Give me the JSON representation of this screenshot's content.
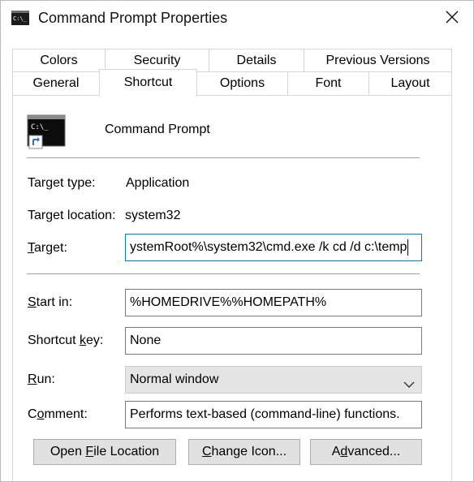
{
  "window": {
    "title": "Command Prompt Properties",
    "icon": "cmd-icon",
    "close_icon": "close-icon"
  },
  "tabs": {
    "row1": [
      {
        "label": "Colors"
      },
      {
        "label": "Security"
      },
      {
        "label": "Details"
      },
      {
        "label": "Previous Versions"
      }
    ],
    "row2": [
      {
        "label": "General"
      },
      {
        "label": "Shortcut",
        "active": true
      },
      {
        "label": "Options"
      },
      {
        "label": "Font"
      },
      {
        "label": "Layout"
      }
    ]
  },
  "shortcut": {
    "name": "Command Prompt",
    "target_type_label": "Target type:",
    "target_type_value": "Application",
    "target_location_label": "Target location:",
    "target_location_value": "system32",
    "target_label_u": "T",
    "target_label_rest": "arget:",
    "target_value": "ystemRoot%\\system32\\cmd.exe /k cd /d c:\\temp",
    "start_in_label_u": "S",
    "start_in_label_rest": "tart in:",
    "start_in_value": "%HOMEDRIVE%%HOMEPATH%",
    "shortcut_key_label_pre": "Shortcut ",
    "shortcut_key_label_u": "k",
    "shortcut_key_label_rest": "ey:",
    "shortcut_key_value": "None",
    "run_label_u": "R",
    "run_label_rest": "un:",
    "run_value": "Normal window",
    "comment_label_pre": "C",
    "comment_label_u": "o",
    "comment_label_rest": "mment:",
    "comment_value": "Performs text-based (command-line) functions."
  },
  "buttons": {
    "open_location_pre": "Open ",
    "open_location_u": "F",
    "open_location_rest": "ile Location",
    "change_icon_u": "C",
    "change_icon_rest": "hange Icon...",
    "advanced_pre": "A",
    "advanced_u": "d",
    "advanced_rest": "vanced..."
  },
  "colors": {
    "focus_border": "#0078d7",
    "button_face": "#e1e1e1",
    "dropdown_face": "#e5e5e5"
  }
}
